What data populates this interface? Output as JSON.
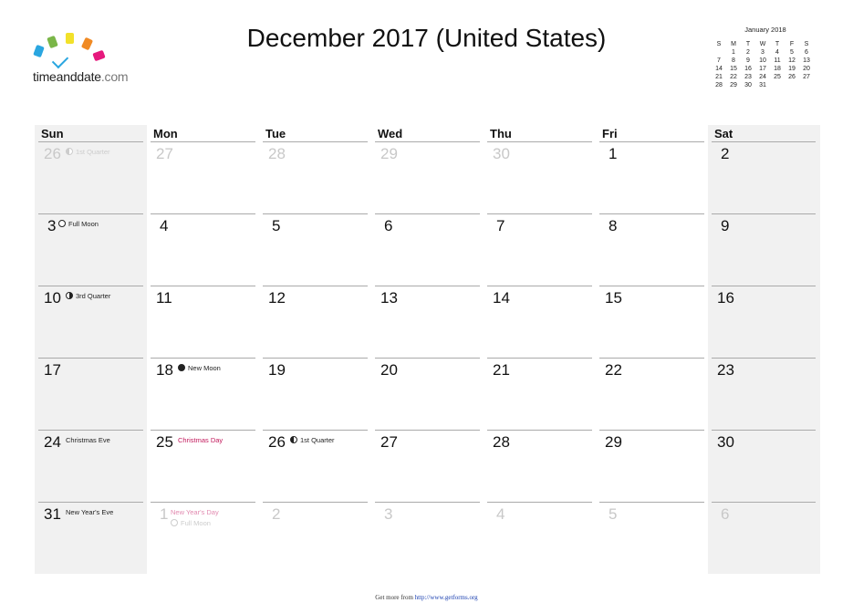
{
  "logo": {
    "brand": "timeanddate",
    "suffix": ".com",
    "colors": [
      "#2aa6e0",
      "#7ab648",
      "#f2e12a",
      "#f08a24",
      "#e6197d"
    ]
  },
  "title": "December 2017 (United States)",
  "mini_calendar": {
    "title": "January 2018",
    "weekdays": [
      "S",
      "M",
      "T",
      "W",
      "T",
      "F",
      "S"
    ],
    "weeks": [
      [
        "",
        "1",
        "2",
        "3",
        "4",
        "5",
        "6"
      ],
      [
        "7",
        "8",
        "9",
        "10",
        "11",
        "12",
        "13"
      ],
      [
        "14",
        "15",
        "16",
        "17",
        "18",
        "19",
        "20"
      ],
      [
        "21",
        "22",
        "23",
        "24",
        "25",
        "26",
        "27"
      ],
      [
        "28",
        "29",
        "30",
        "31",
        "",
        "",
        ""
      ]
    ]
  },
  "calendar": {
    "weekdays": [
      "Sun",
      "Mon",
      "Tue",
      "Wed",
      "Thu",
      "Fri",
      "Sat"
    ],
    "weeks": [
      [
        {
          "day": "26",
          "dim": true,
          "events": [
            {
              "text": "1st Quarter",
              "moon": "first"
            }
          ]
        },
        {
          "day": "27",
          "dim": true,
          "events": []
        },
        {
          "day": "28",
          "dim": true,
          "events": []
        },
        {
          "day": "29",
          "dim": true,
          "events": []
        },
        {
          "day": "30",
          "dim": true,
          "events": []
        },
        {
          "day": "1",
          "dim": false,
          "events": []
        },
        {
          "day": "2",
          "dim": false,
          "events": []
        }
      ],
      [
        {
          "day": "3",
          "dim": false,
          "events": [
            {
              "text": "Full Moon",
              "moon": "full"
            }
          ]
        },
        {
          "day": "4",
          "dim": false,
          "events": []
        },
        {
          "day": "5",
          "dim": false,
          "events": []
        },
        {
          "day": "6",
          "dim": false,
          "events": []
        },
        {
          "day": "7",
          "dim": false,
          "events": []
        },
        {
          "day": "8",
          "dim": false,
          "events": []
        },
        {
          "day": "9",
          "dim": false,
          "events": []
        }
      ],
      [
        {
          "day": "10",
          "dim": false,
          "events": [
            {
              "text": "3rd Quarter",
              "moon": "third"
            }
          ]
        },
        {
          "day": "11",
          "dim": false,
          "events": []
        },
        {
          "day": "12",
          "dim": false,
          "events": []
        },
        {
          "day": "13",
          "dim": false,
          "events": []
        },
        {
          "day": "14",
          "dim": false,
          "events": []
        },
        {
          "day": "15",
          "dim": false,
          "events": []
        },
        {
          "day": "16",
          "dim": false,
          "events": []
        }
      ],
      [
        {
          "day": "17",
          "dim": false,
          "events": []
        },
        {
          "day": "18",
          "dim": false,
          "events": [
            {
              "text": "New Moon",
              "moon": "new"
            }
          ]
        },
        {
          "day": "19",
          "dim": false,
          "events": []
        },
        {
          "day": "20",
          "dim": false,
          "events": []
        },
        {
          "day": "21",
          "dim": false,
          "events": []
        },
        {
          "day": "22",
          "dim": false,
          "events": []
        },
        {
          "day": "23",
          "dim": false,
          "events": []
        }
      ],
      [
        {
          "day": "24",
          "dim": false,
          "events": [
            {
              "text": "Christmas Eve"
            }
          ]
        },
        {
          "day": "25",
          "dim": false,
          "events": [
            {
              "text": "Christmas Day",
              "holiday": true
            }
          ]
        },
        {
          "day": "26",
          "dim": false,
          "events": [
            {
              "text": "1st Quarter",
              "moon": "first"
            }
          ]
        },
        {
          "day": "27",
          "dim": false,
          "events": []
        },
        {
          "day": "28",
          "dim": false,
          "events": []
        },
        {
          "day": "29",
          "dim": false,
          "events": []
        },
        {
          "day": "30",
          "dim": false,
          "events": []
        }
      ],
      [
        {
          "day": "31",
          "dim": false,
          "events": [
            {
              "text": "New Year's Eve"
            }
          ]
        },
        {
          "day": "1",
          "dim": true,
          "events": [
            {
              "text": "New Year's Day",
              "holiday": true
            },
            {
              "text": "Full Moon",
              "moon": "full"
            }
          ]
        },
        {
          "day": "2",
          "dim": true,
          "events": []
        },
        {
          "day": "3",
          "dim": true,
          "events": []
        },
        {
          "day": "4",
          "dim": true,
          "events": []
        },
        {
          "day": "5",
          "dim": true,
          "events": []
        },
        {
          "day": "6",
          "dim": true,
          "events": []
        }
      ]
    ]
  },
  "footer": {
    "prefix": "Get more from ",
    "link": "http://www.getforms.org"
  }
}
